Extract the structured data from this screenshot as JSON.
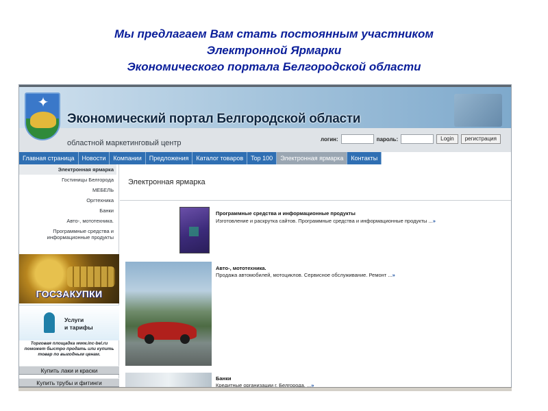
{
  "slide": {
    "title_lines": [
      "Мы предлагаем Вам стать постоянным участником",
      "Электронной Ярмарки",
      "Экономического портала Белгородской области"
    ]
  },
  "portal": {
    "title": "Экономический портал Белгородской области",
    "subtitle": "областной маркетинговый центр",
    "login_label": "логин:",
    "password_label": "пароль:",
    "login_button": "Login",
    "register_button": "регистрация"
  },
  "nav": {
    "items": [
      "Главная страница",
      "Новости",
      "Компании",
      "Предложения",
      "Каталог товаров",
      "Top 100",
      "Электронная ярмарка",
      "Контакты"
    ],
    "active_index": 6
  },
  "sidebar": {
    "items": [
      "Электронная ярмарка",
      "Гостиницы Белгорода",
      "МЕБЕЛЬ",
      "Оргтехника",
      "Банки",
      "Авто-, мототехника.",
      "Программные средства и информационные продукты"
    ],
    "banner_goszakupki": "ГОСЗАКУПКИ",
    "banner_services": "Услуги\nи тарифы",
    "promo_text": "Торговая площадка www.inc-bel.ru поможет быстро продать или купить товар по выгодным ценам.",
    "button_paints": "Купить лаки и краски",
    "button_pipes": "Купить трубы и фитинги"
  },
  "content": {
    "heading": "Электронная ярмарка",
    "items": [
      {
        "title": "Программные средства и информационные продукты",
        "desc": "Изготовление и раскрутка сайтов. Программные средства и информационные продукты ..."
      },
      {
        "title": "Авто-, мототехника.",
        "desc": "Продажа автомобилей, мотоциклов. Сервисное обслуживание. Ремонт ..."
      },
      {
        "title": "Банки",
        "desc": "Кредитные организации г. Белгорода. ..."
      }
    ],
    "more_marker": "»"
  },
  "colors": {
    "slide_title": "#0a1e9a",
    "nav_bg": "#2f6fb3",
    "nav_active": "#9aa6b2"
  }
}
